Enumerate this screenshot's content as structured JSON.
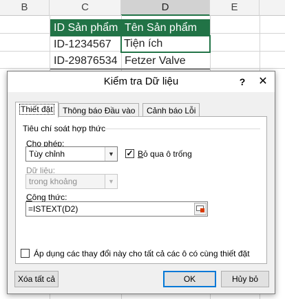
{
  "sheet": {
    "columns": [
      "B",
      "C",
      "D",
      "E"
    ],
    "header_row": [
      "ID Sản phẩm",
      "Tên Sản phẩm"
    ],
    "rows": [
      [
        "ID-1234567",
        "Tiện ích"
      ],
      [
        "ID-29876534",
        "Fetzer Valve"
      ]
    ],
    "header_color": "#217346"
  },
  "dialog": {
    "title": "Kiểm tra Dữ liệu",
    "help_glyph": "?",
    "close_glyph": "✕",
    "tabs": [
      {
        "label": "Thiết đặt",
        "active": true
      },
      {
        "label": "Thông báo Đầu vào",
        "active": false
      },
      {
        "label": "Cảnh báo Lỗi",
        "active": false
      }
    ],
    "criteria_title": "Tiêu chí soát hợp thức",
    "allow": {
      "label_ul": "C",
      "label_rest": "ho phép:",
      "value": "Tùy chỉnh"
    },
    "ignore_blank": {
      "label_ul": "B",
      "label_rest": "ỏ qua ô trống",
      "checked": true,
      "glyph": "✓"
    },
    "data": {
      "label": "Dữ liệu:",
      "value": "trong khoảng"
    },
    "formula": {
      "label_ul": "C",
      "label_rest": "ông thức:",
      "value": "=ISTEXT(D2)"
    },
    "apply_all": {
      "label": "Áp dụng các thay đổi này cho tất cả các ô có cùng thiết đặt",
      "checked": false
    },
    "buttons": {
      "clear_all": "Xóa tất cả",
      "ok": "OK",
      "cancel": "Hủy bỏ"
    }
  }
}
